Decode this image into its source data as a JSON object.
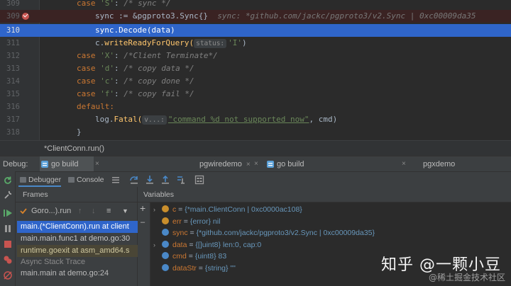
{
  "editor": {
    "lines": [
      {
        "num": "309",
        "breakpoint": false,
        "current": false
      },
      {
        "num": "309",
        "breakpoint": true,
        "current": false
      },
      {
        "num": "310",
        "breakpoint": false,
        "current": true
      },
      {
        "num": "311",
        "breakpoint": false,
        "current": false
      },
      {
        "num": "312",
        "breakpoint": false,
        "current": false
      },
      {
        "num": "313",
        "breakpoint": false,
        "current": false
      },
      {
        "num": "314",
        "breakpoint": false,
        "current": false
      },
      {
        "num": "315",
        "breakpoint": false,
        "current": false
      },
      {
        "num": "316",
        "breakpoint": false,
        "current": false
      },
      {
        "num": "317",
        "breakpoint": false,
        "current": false
      },
      {
        "num": "318",
        "breakpoint": false,
        "current": false
      }
    ],
    "code": {
      "l0_kw": "case",
      "l0_str": "'S'",
      "l0_rest": ": ",
      "l0_cm": "/* sync */",
      "l1_var": "sync := &",
      "l1_pkg": "pgproto3",
      "l1_rest": ".Sync{}",
      "l1_hint": "sync: *github.com/jackc/pgproto3/v2.Sync | 0xc00009da35",
      "l2_code": "sync.Decode(data)",
      "l3_pre": "c.",
      "l3_fn": "writeReadyForQuery(",
      "l3_inlay": "status:",
      "l3_str": "'I'",
      "l3_end": ")",
      "l4_kw": "case",
      "l4_str": "'X'",
      "l4_rest": ": ",
      "l4_cm": "/*Client Terminate*/",
      "l5_kw": "case",
      "l5_str": "'d'",
      "l5_rest": ": ",
      "l5_cm": "/* copy data */",
      "l6_kw": "case",
      "l6_str": "'c'",
      "l6_rest": ": ",
      "l6_cm": "/* copy done */",
      "l7_kw": "case",
      "l7_str": "'f'",
      "l7_rest": ": ",
      "l7_cm": "/* copy fail */",
      "l8_kw": "default:",
      "l9_pre": "log.",
      "l9_fn": "Fatal(",
      "l9_inlay": "v...:",
      "l9_str": "\"command %d not supported now\"",
      "l9_end": ", cmd)",
      "l10_code": "}"
    },
    "breadcrumb": "*ClientConn.run()"
  },
  "debug_bar": {
    "label": "Debug:",
    "tabs": [
      {
        "label": "go build",
        "close": "×"
      },
      {
        "label": "pgwiredemo",
        "close": "×"
      },
      {
        "label": "go build",
        "close": "×"
      },
      {
        "label": "pgxdemo",
        "close": ""
      }
    ]
  },
  "debugger_tabs": {
    "debugger": "Debugger",
    "console": "Console"
  },
  "frames": {
    "header": "Frames",
    "thread": "Goro...).run",
    "items": [
      "main.(*ClientConn).run at client",
      "main.main.func1 at demo.go:30",
      "runtime.goexit at asm_amd64.s",
      "Async Stack Trace",
      "main.main at demo.go:24"
    ]
  },
  "variables": {
    "header": "Variables",
    "items": [
      {
        "arrow": "›",
        "name": "c",
        "eq": " = ",
        "value": "{*main.ClientConn | 0xc0000ac108}",
        "icon_color": "#c98e2c"
      },
      {
        "arrow": "",
        "name": "err",
        "eq": " = ",
        "value": "{error} nil",
        "icon_color": "#c98e2c"
      },
      {
        "arrow": "",
        "name": "sync",
        "eq": " = ",
        "value": "{*github.com/jackc/pgproto3/v2.Sync | 0xc00009da35}",
        "icon_color": "#4a88c7"
      },
      {
        "arrow": "›",
        "name": "data",
        "eq": " = ",
        "value": "{[]uint8} len:0, cap:0",
        "icon_color": "#4a88c7"
      },
      {
        "arrow": "",
        "name": "cmd",
        "eq": " = ",
        "value": "{uint8} 83",
        "icon_color": "#4a88c7"
      },
      {
        "arrow": "",
        "name": "dataStr",
        "eq": " = ",
        "value": "{string} \"\"",
        "icon_color": "#4a88c7"
      }
    ]
  },
  "watermark": {
    "main": "知乎 @一颗小豆",
    "sub": "@稀土掘金技术社区"
  }
}
